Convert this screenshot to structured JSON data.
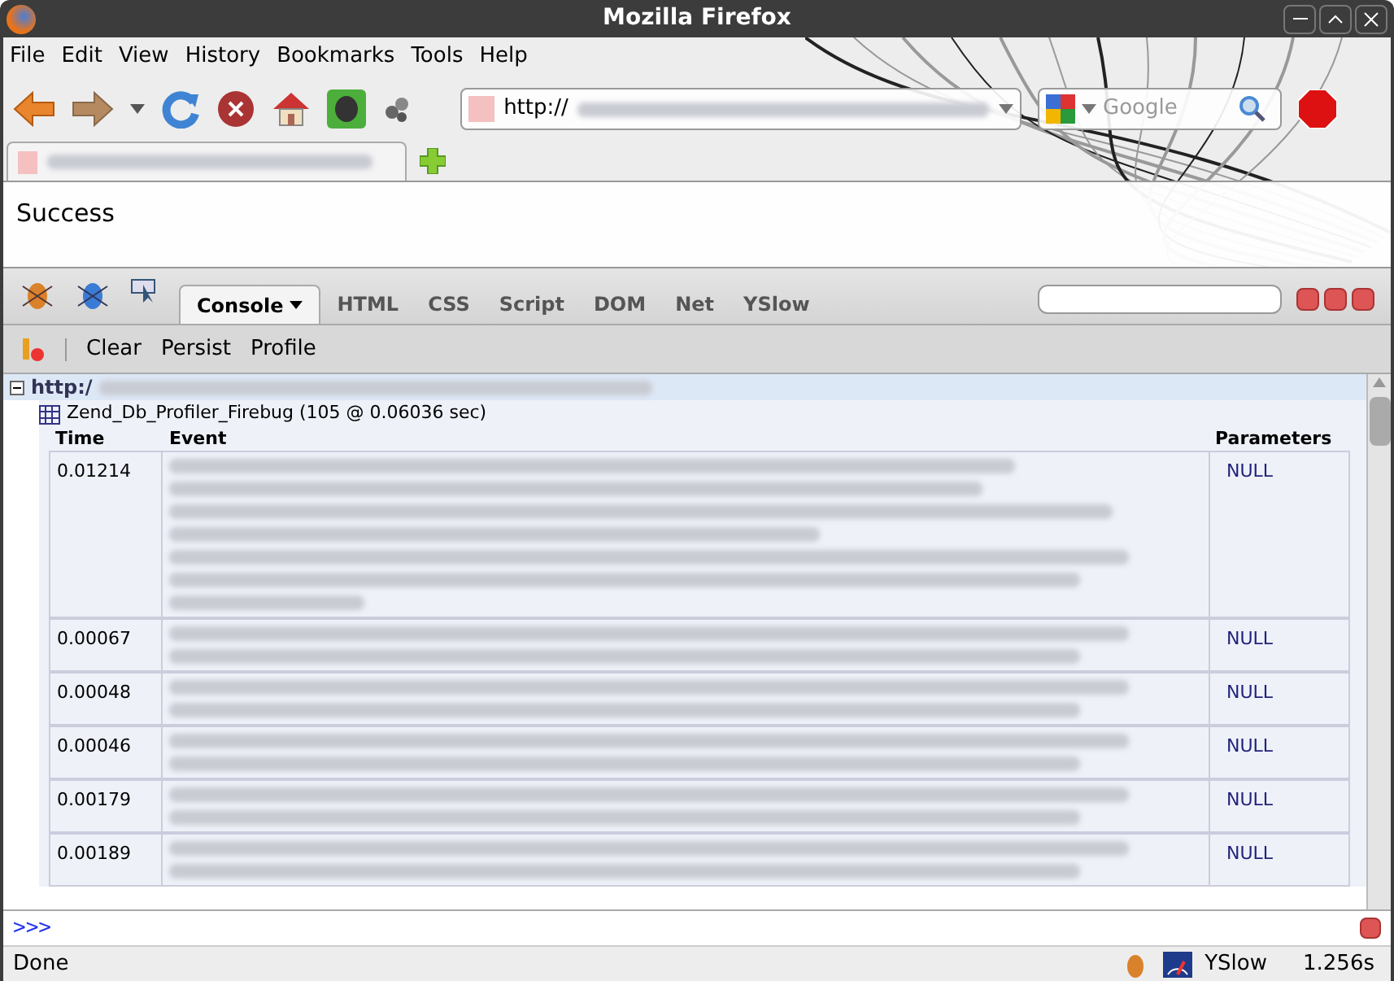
{
  "window": {
    "title": "Mozilla Firefox"
  },
  "menu": [
    "File",
    "Edit",
    "View",
    "History",
    "Bookmarks",
    "Tools",
    "Help"
  ],
  "address": {
    "value": "http://"
  },
  "search": {
    "placeholder": "Google"
  },
  "page": {
    "text": "Success"
  },
  "firebug": {
    "tabs": [
      {
        "label": "Console",
        "selected": true
      },
      {
        "label": "HTML",
        "selected": false
      },
      {
        "label": "CSS",
        "selected": false
      },
      {
        "label": "Script",
        "selected": false
      },
      {
        "label": "DOM",
        "selected": false
      },
      {
        "label": "Net",
        "selected": false
      },
      {
        "label": "YSlow",
        "selected": false
      }
    ],
    "toolbar": [
      "Clear",
      "Persist",
      "Profile"
    ],
    "request": {
      "url": "http:/",
      "expanded": true
    },
    "profiler": {
      "title": "Zend_Db_Profiler_Firebug (105 @ 0.06036 sec)"
    },
    "columns": [
      "Time",
      "Event",
      "Parameters"
    ],
    "rows": [
      {
        "time": "0.01214",
        "params": "NULL"
      },
      {
        "time": "0.00067",
        "params": "NULL"
      },
      {
        "time": "0.00048",
        "params": "NULL"
      },
      {
        "time": "0.00046",
        "params": "NULL"
      },
      {
        "time": "0.00179",
        "params": "NULL"
      },
      {
        "time": "0.00189",
        "params": "NULL"
      }
    ],
    "command_prompt": ">>>"
  },
  "status_bar": {
    "text": "Done",
    "yslow": "YSlow",
    "time": "1.256s"
  }
}
